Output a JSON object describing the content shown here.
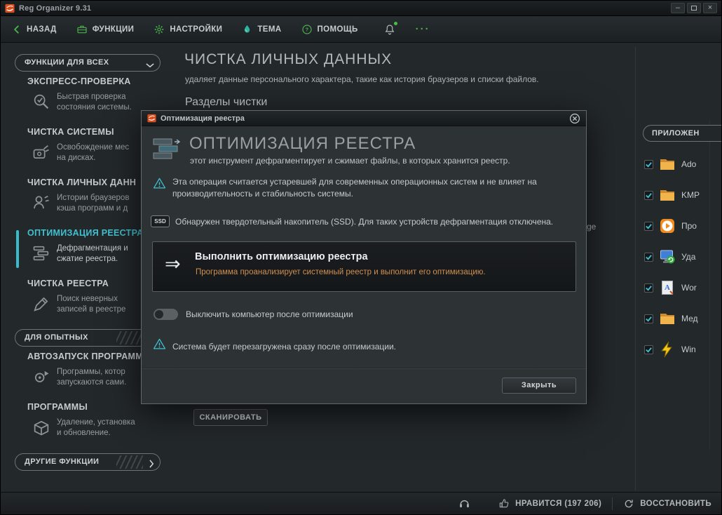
{
  "window": {
    "title": "Reg Organizer 9.31",
    "controls": {
      "minimize": "–",
      "close": "×"
    }
  },
  "toolbar": {
    "back": "НАЗАД",
    "functions": "ФУНКЦИИ",
    "settings": "НАСТРОЙКИ",
    "theme": "ТЕМА",
    "help": "ПОМОЩЬ",
    "more": "···"
  },
  "sidebar": {
    "header_all": "ФУНКЦИИ ДЛЯ ВСЕХ",
    "header_advanced": "ДЛЯ ОПЫТНЫХ",
    "header_other": "ДРУГИЕ ФУНКЦИИ",
    "items": [
      {
        "title": "ЭКСПРЕСС-ПРОВЕРКА",
        "line1": "Быстрая проверка",
        "line2": "состояния системы."
      },
      {
        "title": "ЧИСТКА СИСТЕМЫ",
        "line1": "Освобождение мес",
        "line2": "на дисках."
      },
      {
        "title": "ЧИСТКА ЛИЧНЫХ ДАНН",
        "line1": "Истории браузеров",
        "line2": "кэша программ и д"
      },
      {
        "title": "ОПТИМИЗАЦИЯ РЕЕСТРА",
        "line1": "Дефрагментация и",
        "line2": "сжатие реестра."
      },
      {
        "title": "ЧИСТКА РЕЕСТРА",
        "line1": "Поиск неверных",
        "line2": "записей в реестре"
      },
      {
        "title": "АВТОЗАПУСК ПРОГРАММ",
        "line1": "Программы, котор",
        "line2": "запускаются сами."
      },
      {
        "title": "ПРОГРАММЫ",
        "line1": "Удаление, установка",
        "line2": "и обновление."
      }
    ]
  },
  "main": {
    "title": "ЧИСТКА ЛИЧНЫХ ДАННЫХ",
    "subtitle": "удаляет данные персонального характера, такие как история браузеров и списки файлов.",
    "section": "Разделы чистки",
    "covered_fragment": "ge",
    "scan_button": "СКАНИРОВАТЬ",
    "apps_header": "ПРИЛОЖЕН",
    "apps": [
      {
        "label": "Ado",
        "checked": true,
        "icon": "folder-icon"
      },
      {
        "label": "KMP",
        "checked": true,
        "icon": "folder-icon"
      },
      {
        "label": "Про",
        "checked": true,
        "icon": "media-player-icon"
      },
      {
        "label": "Уда",
        "checked": true,
        "icon": "uninstall-monitor-icon"
      },
      {
        "label": "Wor",
        "checked": true,
        "icon": "document-icon"
      },
      {
        "label": "Мед",
        "checked": true,
        "icon": "folder-icon"
      },
      {
        "label": "Win",
        "checked": true,
        "icon": "lightning-icon"
      }
    ]
  },
  "dialog": {
    "title": "Оптимизация реестра",
    "heading": "ОПТИМИЗАЦИЯ РЕЕСТРА",
    "subheading": "этот инструмент дефрагментирует и сжимает файлы, в которых хранится реестр.",
    "warning_deprecated": "Эта операция считается устаревшей для современных операционных систем и не влияет на производительность и стабильность системы.",
    "ssd_badge": "SSD",
    "ssd_note": "Обнаружен твердотельный накопитель (SSD). Для таких устройств дефрагментация отключена.",
    "action_title": "Выполнить оптимизацию реестра",
    "action_desc": "Программа проанализирует системный реестр и выполнит его оптимизацию.",
    "action_arrow": "⇒",
    "toggle_label": "Выключить компьютер после оптимизации",
    "warning_restart": "Система будет перезагружена сразу после оптимизации.",
    "close_button": "Закрыть"
  },
  "statusbar": {
    "like": "НРАВИТСЯ (197 206)",
    "restore": "ВОССТАНОВИТЬ"
  },
  "colors": {
    "accent_cyan": "#3fc1d1",
    "accent_green": "#4db14d",
    "logo_orange": "#d94e1f",
    "action_desc_orange": "#d08f4f"
  }
}
